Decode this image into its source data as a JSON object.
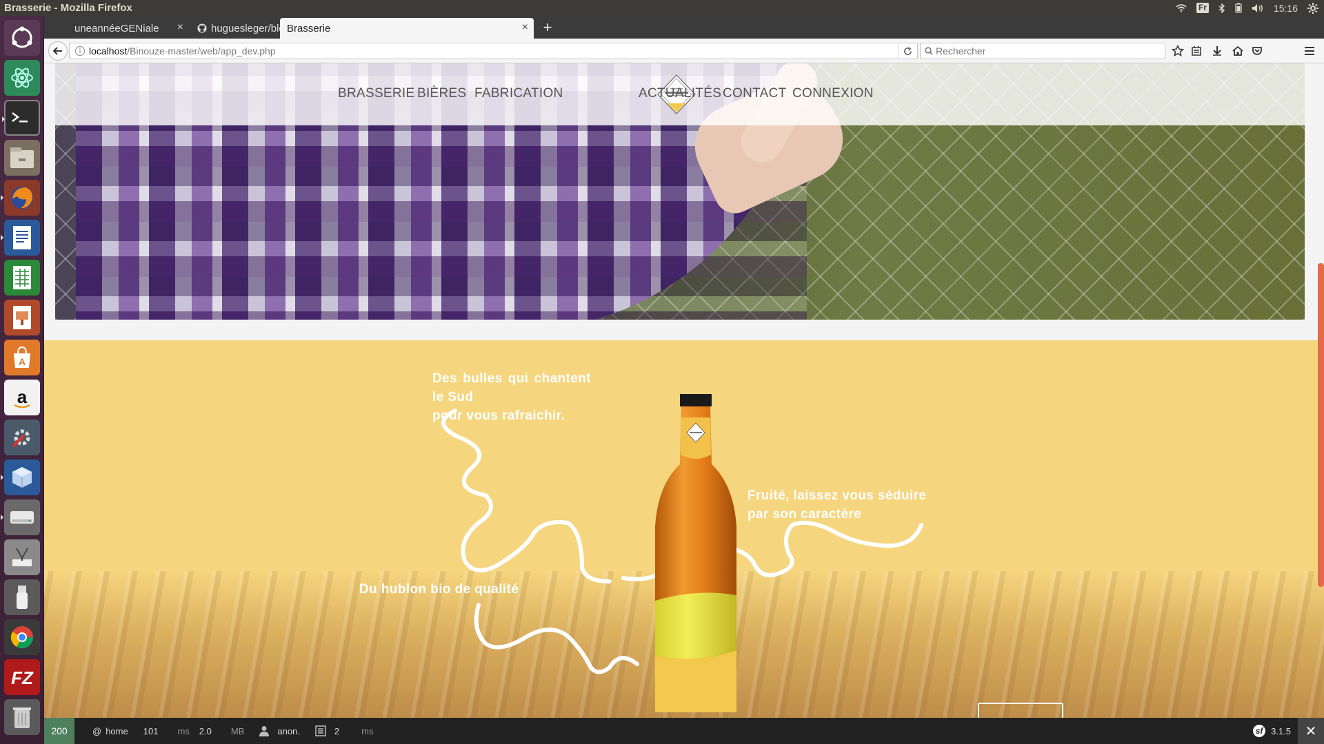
{
  "os": {
    "window_title": "Brasserie - Mozilla Firefox",
    "keyboard_layout": "Fr",
    "clock": "15:16"
  },
  "launcher": {
    "items": [
      {
        "name": "ubuntu-dash-icon"
      },
      {
        "name": "atom-icon"
      },
      {
        "name": "terminal-icon"
      },
      {
        "name": "files-icon"
      },
      {
        "name": "firefox-icon"
      },
      {
        "name": "writer-icon"
      },
      {
        "name": "calc-icon"
      },
      {
        "name": "impress-icon"
      },
      {
        "name": "software-center-icon"
      },
      {
        "name": "amazon-icon"
      },
      {
        "name": "system-settings-icon"
      },
      {
        "name": "virtualbox-icon"
      },
      {
        "name": "disk-icon"
      },
      {
        "name": "mysql-workbench-icon"
      },
      {
        "name": "usb-icon"
      },
      {
        "name": "chrome-icon"
      },
      {
        "name": "filezilla-icon"
      },
      {
        "name": "trash-icon"
      }
    ]
  },
  "browser": {
    "tabs": [
      {
        "label": "uneannéeGENiale"
      },
      {
        "label": "huguesleger/blogP…"
      },
      {
        "label": "Brasserie"
      }
    ],
    "url_host": "localhost",
    "url_path": "/Binouze-master/web/app_dev.php",
    "search_placeholder": "Rechercher"
  },
  "site": {
    "menu_left": [
      "BRASSERIE",
      "BIÈRES",
      "FABRICATION"
    ],
    "menu_right": [
      "ACTUALITÉS",
      "CONTACT",
      "CONNEXION"
    ],
    "beer": {
      "text_top_line1": "Des bulles qui chantent le Sud",
      "text_top_line2": "pour vous rafraichir.",
      "text_right_line1": "Fruité, laissez vous séduire",
      "text_right_line2": "par son caractère",
      "text_bottom": "Du hublon bio de qualité"
    },
    "colors": {
      "beer_bg": "#f5d57e",
      "nav_text": "#555555",
      "accent": "#e36b4c"
    }
  },
  "symfony_toolbar": {
    "status_code": "200",
    "route": "home",
    "time_value": "101",
    "time_unit": "ms",
    "memory_value": "2.0",
    "memory_unit": "MB",
    "user": "anon.",
    "db_queries": "2",
    "db_unit": "ms",
    "version": "3.1.5"
  }
}
